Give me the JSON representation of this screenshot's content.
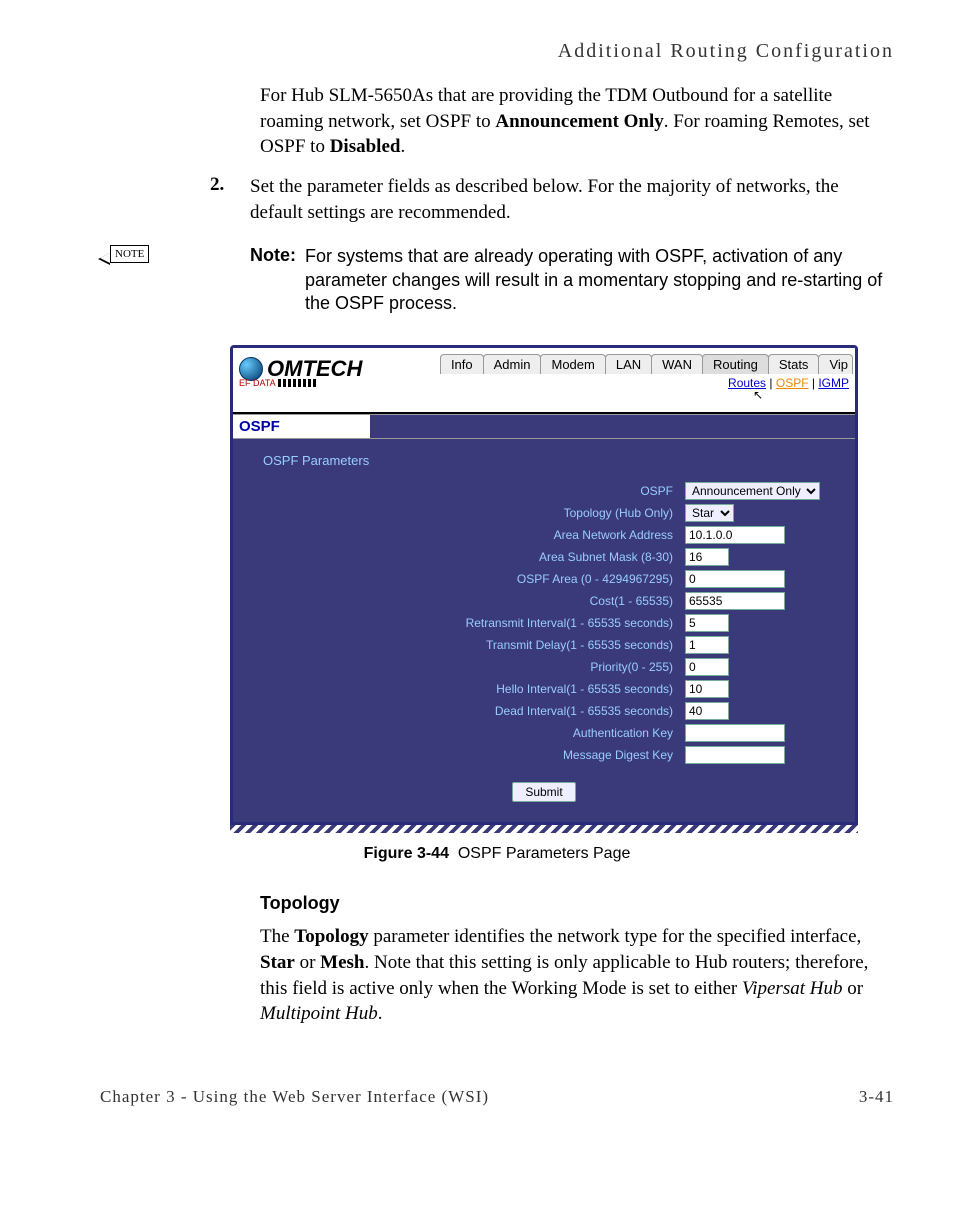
{
  "page_header": "Additional Routing Configuration",
  "intro_para": "For Hub SLM-5650As that are providing the TDM Outbound for a satellite roaming network, set OSPF to ",
  "intro_bold1": "Announcement Only",
  "intro_mid": ". For roaming Remotes, set OSPF to ",
  "intro_bold2": "Disabled",
  "intro_end": ".",
  "step_num": "2.",
  "step_text": "Set the parameter fields as described below. For the majority of networks, the default settings are recommended.",
  "note_box": "NOTE",
  "note_label": "Note:",
  "note_text": "For systems that are already operating with OSPF, activation of any parameter changes will result in a momentary stopping and re-starting of the OSPF process.",
  "app": {
    "logo_main": "OMTECH",
    "logo_sub": "EF DATA",
    "tabs": [
      "Info",
      "Admin",
      "Modem",
      "LAN",
      "WAN",
      "Routing",
      "Stats",
      "Vip"
    ],
    "active_tab_index": 5,
    "subnav": {
      "routes": "Routes",
      "ospf": "OSPF",
      "igmp": "IGMP"
    },
    "section": "OSPF",
    "panel_title": "OSPF Parameters",
    "fields": {
      "ospf_label": "OSPF",
      "ospf_value": "Announcement Only",
      "topology_label": "Topology (Hub Only)",
      "topology_value": "Star",
      "area_net_label": "Area Network Address",
      "area_net_value": "10.1.0.0",
      "subnet_label": "Area Subnet Mask (8-30)",
      "subnet_value": "16",
      "ospf_area_label": "OSPF Area (0 - 4294967295)",
      "ospf_area_value": "0",
      "cost_label": "Cost(1 - 65535)",
      "cost_value": "65535",
      "retrans_label": "Retransmit Interval(1 - 65535 seconds)",
      "retrans_value": "5",
      "txdelay_label": "Transmit Delay(1 - 65535 seconds)",
      "txdelay_value": "1",
      "priority_label": "Priority(0 - 255)",
      "priority_value": "0",
      "hello_label": "Hello Interval(1 - 65535 seconds)",
      "hello_value": "10",
      "dead_label": "Dead Interval(1 - 65535 seconds)",
      "dead_value": "40",
      "authkey_label": "Authentication Key",
      "authkey_value": "",
      "msgdigest_label": "Message Digest Key",
      "msgdigest_value": ""
    },
    "submit": "Submit"
  },
  "figure_label_bold": "Figure 3-44",
  "figure_label_rest": "OSPF Parameters Page",
  "subheading": "Topology",
  "topology_para_1": "The ",
  "topology_para_b1": "Topology",
  "topology_para_2": " parameter identifies the network type for the specified interface, ",
  "topology_para_b2": "Star",
  "topology_para_3": " or ",
  "topology_para_b3": "Mesh",
  "topology_para_4": ". Note that this setting is only applicable to Hub routers; therefore, this field is active only when the Working Mode is set to either ",
  "topology_para_i1": "Vipersat Hub",
  "topology_para_5": " or ",
  "topology_para_i2": "Multipoint Hub",
  "topology_para_6": ".",
  "footer_left": "Chapter 3 - Using the Web Server Interface (WSI)",
  "footer_right": "3-41"
}
